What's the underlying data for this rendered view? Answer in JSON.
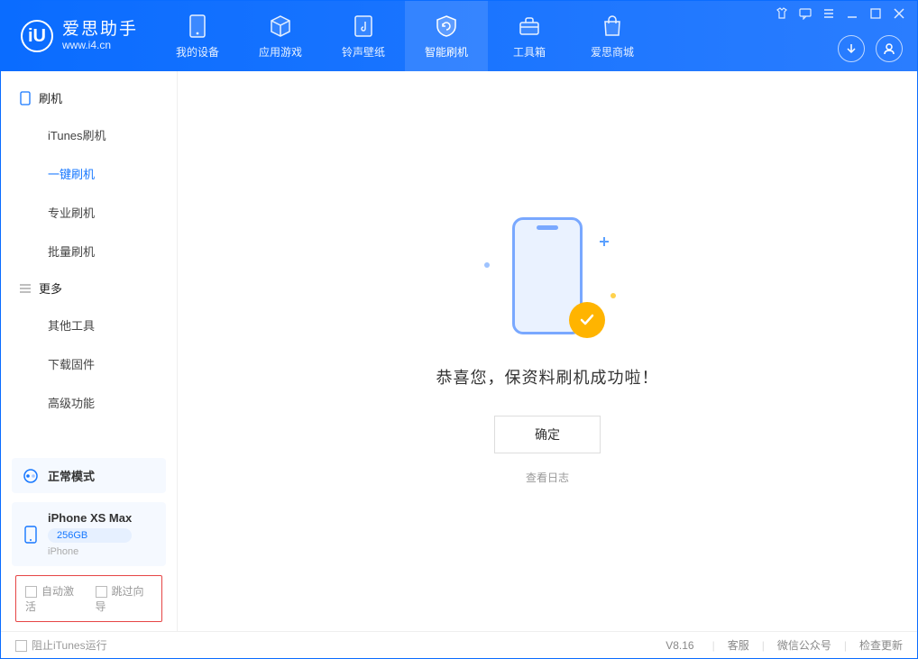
{
  "app": {
    "logo_letter": "iU",
    "title_cn": "爱思助手",
    "url": "www.i4.cn"
  },
  "topnav": {
    "items": [
      {
        "label": "我的设备"
      },
      {
        "label": "应用游戏"
      },
      {
        "label": "铃声壁纸"
      },
      {
        "label": "智能刷机"
      },
      {
        "label": "工具箱"
      },
      {
        "label": "爱思商城"
      }
    ]
  },
  "sidebar": {
    "group1_title": "刷机",
    "group1": [
      {
        "label": "iTunes刷机"
      },
      {
        "label": "一键刷机"
      },
      {
        "label": "专业刷机"
      },
      {
        "label": "批量刷机"
      }
    ],
    "group2_title": "更多",
    "group2": [
      {
        "label": "其他工具"
      },
      {
        "label": "下载固件"
      },
      {
        "label": "高级功能"
      }
    ],
    "mode_label": "正常模式",
    "device_name": "iPhone XS Max",
    "device_capacity": "256GB",
    "device_type": "iPhone",
    "check_auto_activate": "自动激活",
    "check_skip_guide": "跳过向导"
  },
  "main": {
    "success_message": "恭喜您，保资料刷机成功啦！",
    "ok_button": "确定",
    "view_log": "查看日志"
  },
  "footer": {
    "stop_itunes": "阻止iTunes运行",
    "version": "V8.16",
    "support": "客服",
    "wechat": "微信公众号",
    "check_update": "检查更新"
  }
}
